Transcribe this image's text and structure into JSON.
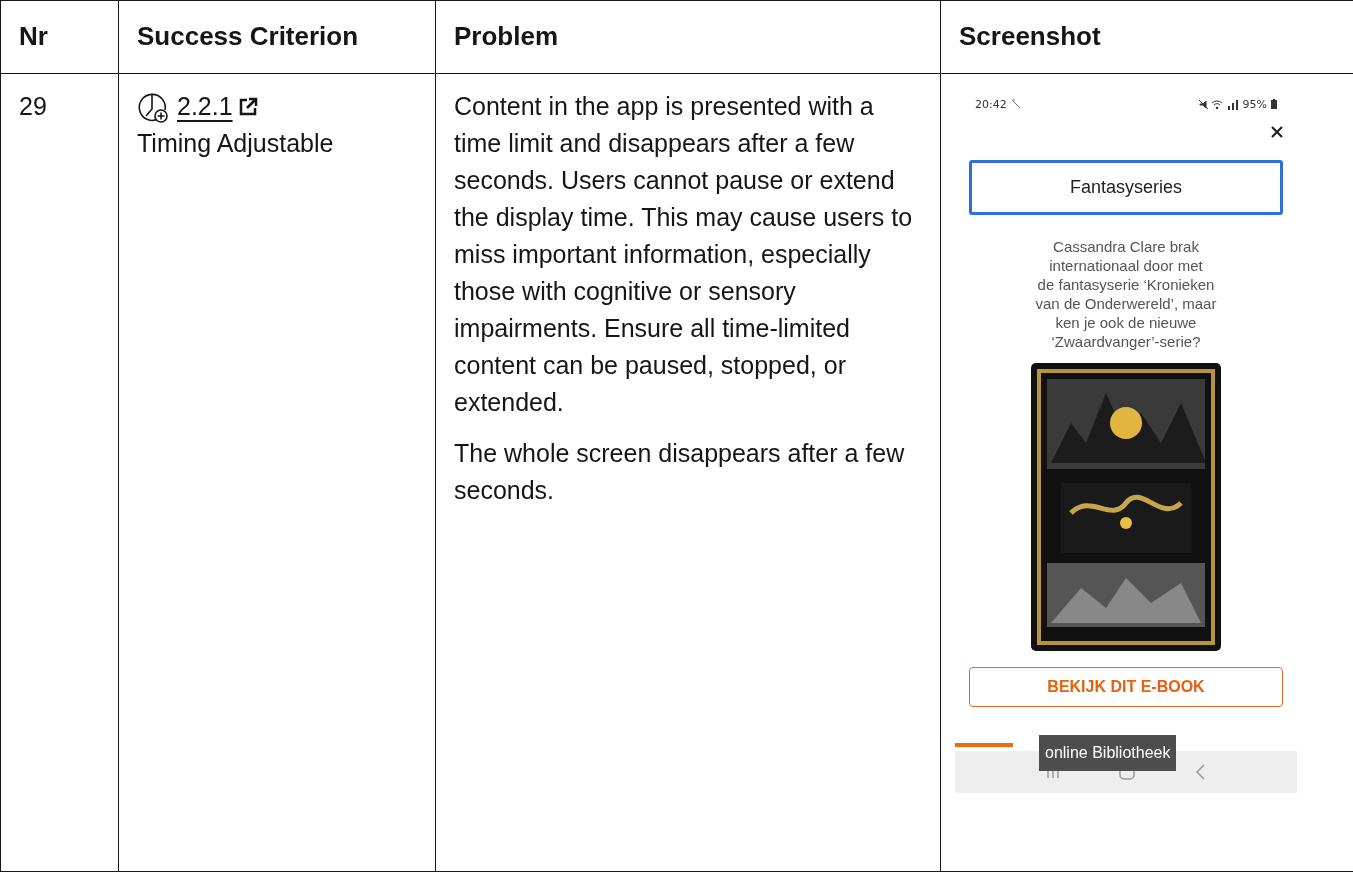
{
  "table": {
    "columns": [
      "Nr",
      "Success Criterion",
      "Problem",
      "Screenshot"
    ],
    "rows": [
      {
        "nr": "29",
        "criterion": {
          "number": "2.2.1",
          "name": "Timing Adjustable"
        },
        "problem": [
          "Content in the app is presented with a time limit and disappears after a few seconds. Users cannot pause or extend the display time. This may cause users to miss important information, especially those with cognitive or sensory impairments. Ensure all time-limited content can be paused, stopped, or extended.",
          "The whole screen disappears after a few seconds."
        ],
        "screenshot": {
          "time": "20:42",
          "battery": "95%",
          "heading": "Fantasyseries",
          "text": "Cassandra Clare brak\ninternationaal door met\nde fantasyserie ‘Kronieken\nvan de Onderwereld’, maar\nken je ook de nieuwe\n‘Zwaardvanger’-serie?",
          "button": "BEKIJK DIT E-BOOK",
          "tooltip": "online Bibliotheek"
        }
      }
    ]
  }
}
